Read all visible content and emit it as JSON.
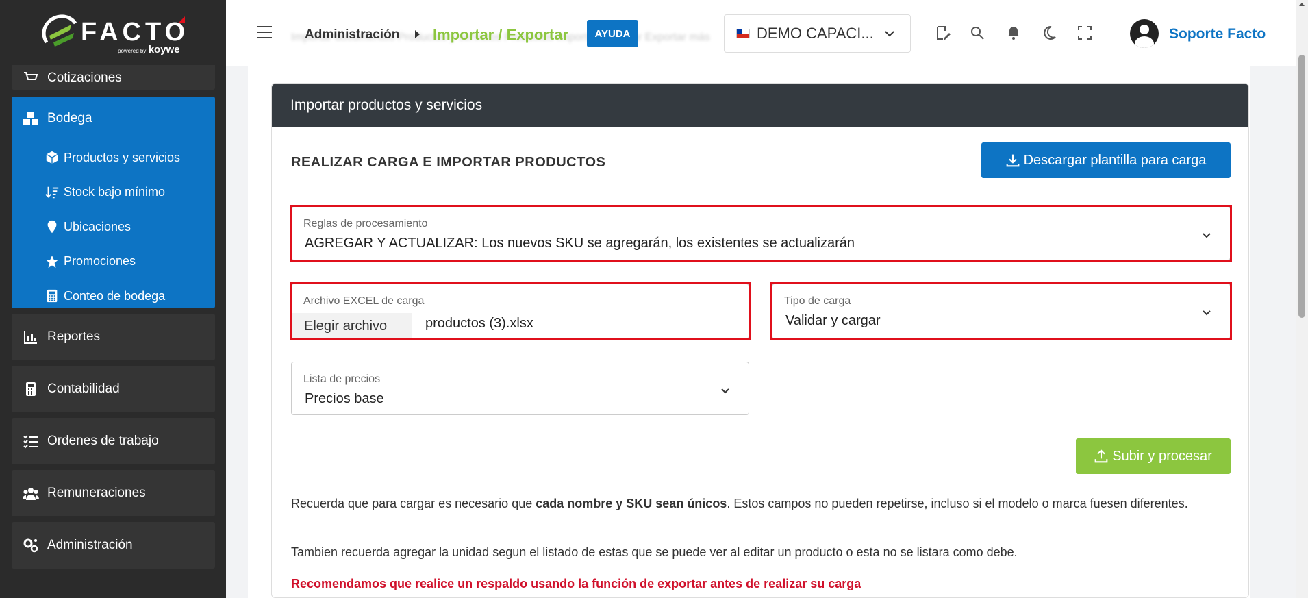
{
  "logo": {
    "wordmark": "FACTO",
    "powered": "powered by",
    "brand": "koywe"
  },
  "sidebar": {
    "cut_item": "Cotizaciones",
    "bodega": {
      "label": "Bodega",
      "items": [
        {
          "label": "Productos y servicios",
          "icon": "cube-icon"
        },
        {
          "label": "Stock bajo mínimo",
          "icon": "sort-desc-icon"
        },
        {
          "label": "Ubicaciones",
          "icon": "location-pin-icon"
        },
        {
          "label": "Promociones",
          "icon": "star-icon"
        },
        {
          "label": "Conteo de bodega",
          "icon": "calculator-icon"
        }
      ]
    },
    "items": [
      {
        "label": "Reportes",
        "icon": "bar-chart-icon"
      },
      {
        "label": "Contabilidad",
        "icon": "calculator-icon"
      },
      {
        "label": "Ordenes de trabajo",
        "icon": "task-list-icon"
      },
      {
        "label": "Remuneraciones",
        "icon": "users-icon"
      },
      {
        "label": "Administración",
        "icon": "cogs-icon"
      }
    ]
  },
  "header": {
    "breadcrumb": [
      "Administración",
      "Importar / Exportar"
    ],
    "help_label": "AYUDA",
    "company": "DEMO CAPACI...",
    "user": "Soporte Facto",
    "ghost_tabs": "Importar documentos    Productos y servicios    Productos    Importar    Exportar    Exportar más"
  },
  "card": {
    "title": "Importar productos y servicios",
    "section_title": "REALIZAR CARGA E IMPORTAR PRODUCTOS",
    "download_label": "Descargar plantilla para carga",
    "rules": {
      "label": "Reglas de procesamiento",
      "value": "AGREGAR Y ACTUALIZAR: Los nuevos SKU se agregarán, los existentes se actualizarán"
    },
    "file": {
      "label": "Archivo EXCEL de carga",
      "button": "Elegir archivo",
      "filename": "productos (3).xlsx"
    },
    "load_type": {
      "label": "Tipo de carga",
      "value": "Validar y cargar"
    },
    "price_list": {
      "label": "Lista de precios",
      "value": "Precios base"
    },
    "upload_label": "Subir y procesar",
    "note1_a": "Recuerda que para cargar es necesario que ",
    "note1_b": "cada nombre y SKU sean únicos",
    "note1_c": ". Estos campos no pueden repetirse, incluso si el modelo o marca fuesen diferentes.",
    "note2": "Tambien recuerda agregar la unidad segun el listado de estas que se puede ver al editar un producto o esta no se listara como debe.",
    "warning": "Recomendamos que realice un respaldo usando la función de exportar antes de realizar su carga"
  },
  "colors": {
    "primary": "#0d74c4",
    "accent_green": "#8cc63f",
    "highlight_red": "#e0101c",
    "sidebar": "#2b2b2b",
    "card_header": "#343a40"
  }
}
